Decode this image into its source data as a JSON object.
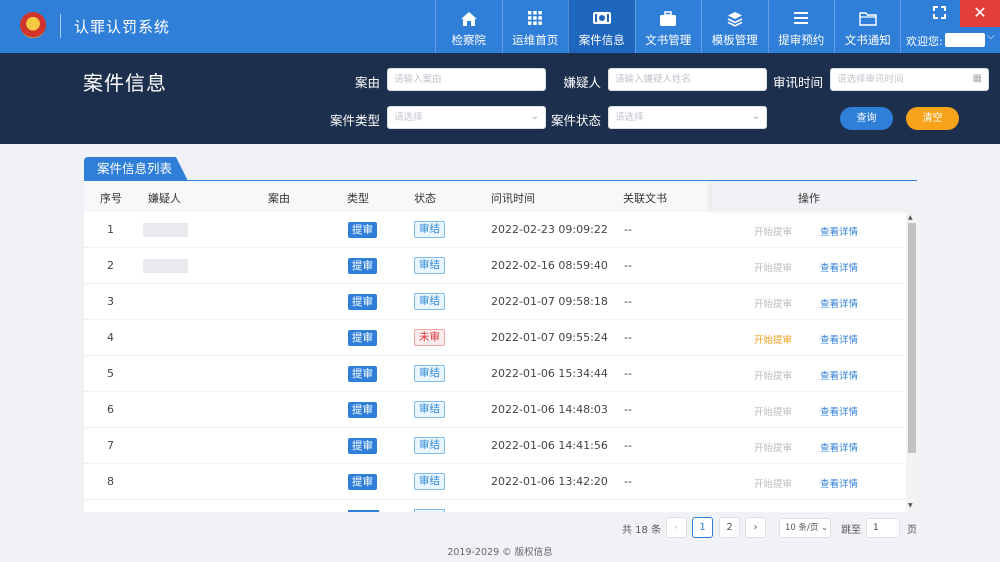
{
  "app": {
    "title": "认罪认罚系统"
  },
  "nav": {
    "items": [
      {
        "label": "检察院",
        "icon": "home-icon"
      },
      {
        "label": "运维首页",
        "icon": "grid-icon"
      },
      {
        "label": "案件信息",
        "icon": "banknote-icon",
        "active": true
      },
      {
        "label": "文书管理",
        "icon": "briefcase-icon"
      },
      {
        "label": "模板管理",
        "icon": "layers-icon"
      },
      {
        "label": "提审预约",
        "icon": "list-icon"
      },
      {
        "label": "文书通知",
        "icon": "folder-icon"
      }
    ],
    "welcome": "欢迎您:"
  },
  "search": {
    "page_title": "案件信息",
    "case_reason_label": "案由",
    "case_reason_placeholder": "请输入案由",
    "suspect_label": "嫌疑人",
    "suspect_placeholder": "请输入嫌疑人姓名",
    "interrogation_time_label": "审讯时间",
    "interrogation_time_placeholder": "请选择审讯时间",
    "case_type_label": "案件类型",
    "case_type_placeholder": "请选择",
    "case_status_label": "案件状态",
    "case_status_placeholder": "请选择",
    "query_button": "查询",
    "clear_button": "清空"
  },
  "list": {
    "tab_title": "案件信息列表",
    "columns": {
      "index": "序号",
      "suspect": "嫌疑人",
      "reason": "案由",
      "type": "类型",
      "status": "状态",
      "time": "问讯时间",
      "document": "关联文书",
      "operation": "操作"
    },
    "rows": [
      {
        "index": "1",
        "type": "提审",
        "status": "审结",
        "pending": false,
        "time": "2022-02-23 09:09:22",
        "document": "--",
        "start": "开始提审",
        "detail": "查看详情"
      },
      {
        "index": "2",
        "type": "提审",
        "status": "审结",
        "pending": false,
        "time": "2022-02-16 08:59:40",
        "document": "--",
        "start": "开始提审",
        "detail": "查看详情"
      },
      {
        "index": "3",
        "type": "提审",
        "status": "审结",
        "pending": false,
        "time": "2022-01-07 09:58:18",
        "document": "--",
        "start": "开始提审",
        "detail": "查看详情"
      },
      {
        "index": "4",
        "type": "提审",
        "status": "未审",
        "pending": true,
        "time": "2022-01-07 09:55:24",
        "document": "--",
        "start": "开始提审",
        "detail": "查看详情"
      },
      {
        "index": "5",
        "type": "提审",
        "status": "审结",
        "pending": false,
        "time": "2022-01-06 15:34:44",
        "document": "--",
        "start": "开始提审",
        "detail": "查看详情"
      },
      {
        "index": "6",
        "type": "提审",
        "status": "审结",
        "pending": false,
        "time": "2022-01-06 14:48:03",
        "document": "--",
        "start": "开始提审",
        "detail": "查看详情"
      },
      {
        "index": "7",
        "type": "提审",
        "status": "审结",
        "pending": false,
        "time": "2022-01-06 14:41:56",
        "document": "--",
        "start": "开始提审",
        "detail": "查看详情"
      },
      {
        "index": "8",
        "type": "提审",
        "status": "审结",
        "pending": false,
        "time": "2022-01-06 13:42:20",
        "document": "--",
        "start": "开始提审",
        "detail": "查看详情"
      }
    ]
  },
  "pagination": {
    "total": "共 18 条",
    "prev": "‹",
    "pages": [
      "1",
      "2"
    ],
    "next": "›",
    "page_size": "10 条/页",
    "jump_label": "跳至",
    "jump_value": "1",
    "page_unit": "页"
  },
  "footer": {
    "copyright": "2019-2029 © 版权信息"
  }
}
